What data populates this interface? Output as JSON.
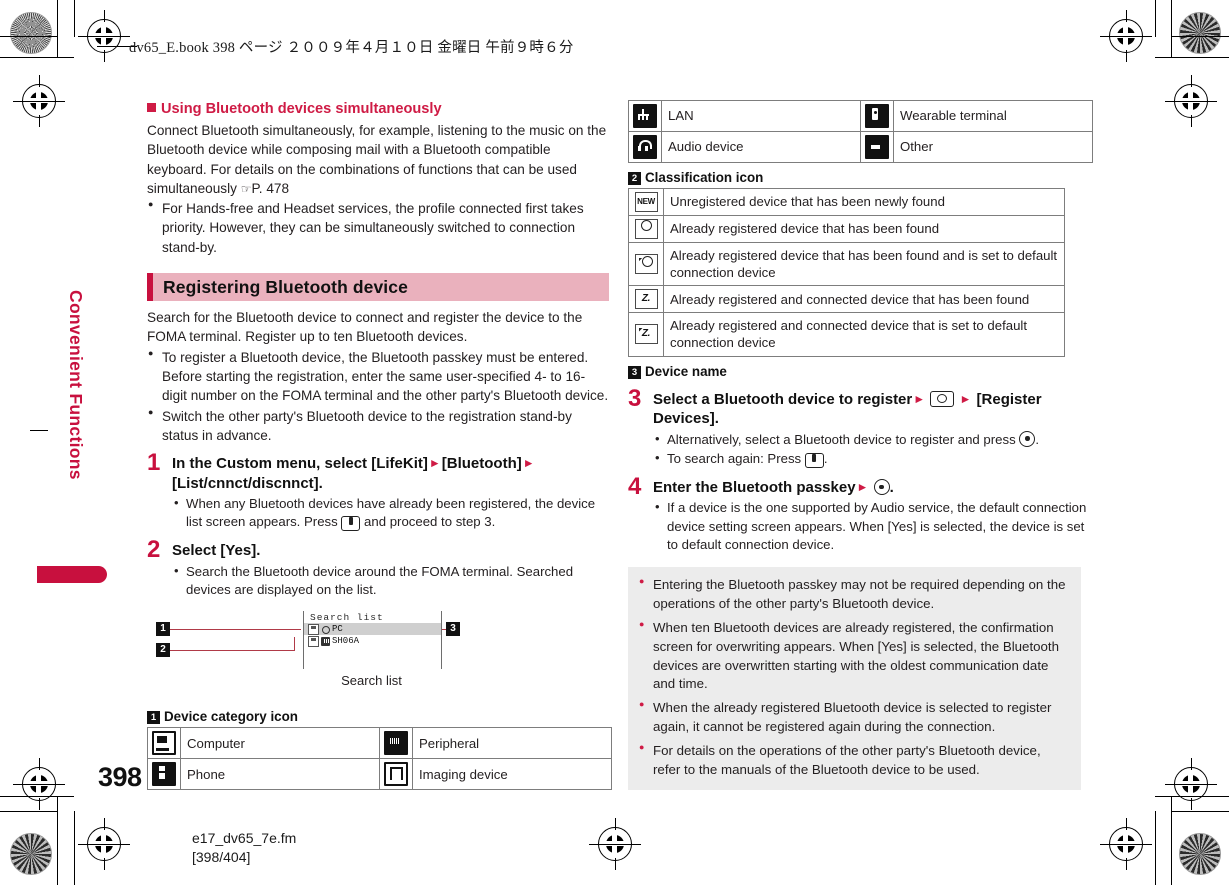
{
  "printer": {
    "running_head": "dv65_E.book   398 ページ   ２００９年４月１０日   金曜日   午前９時６分",
    "page_number": "398",
    "filename_line1": "e17_dv65_7e.fm",
    "filename_line2": "[398/404]"
  },
  "side_tab": {
    "label": "Convenient Functions"
  },
  "left_column": {
    "subhead": "Using Bluetooth devices simultaneously",
    "intro": "Connect Bluetooth simultaneously, for example, listening to the music on the Bluetooth device while composing mail with a Bluetooth compatible keyboard. For details on the combinations of functions that can be used simultaneously ",
    "intro_ref": "P. 478",
    "intro_bullets": [
      "For Hands-free and Headset services, the profile connected first takes priority. However, they can be simultaneously switched to connection stand-by."
    ],
    "section_title": "Registering Bluetooth device",
    "section_intro": "Search for the Bluetooth device to connect and register the device to the FOMA terminal. Register up to ten Bluetooth devices.",
    "section_bullets": [
      "To register a Bluetooth device, the Bluetooth passkey must be entered. Before starting the registration, enter the same user-specified 4- to 16-digit number on the FOMA terminal and the other party's Bluetooth device.",
      "Switch the other party's Bluetooth device to the registration stand-by status in advance."
    ],
    "steps": [
      {
        "num": "1",
        "title_a": "In the Custom menu, select [LifeKit]",
        "title_b": "[Bluetooth]",
        "title_c": "[List/cnnct/discnnct].",
        "notes_pre": "When any Bluetooth devices have already been registered, the device list screen appears. Press ",
        "notes_post": " and proceed to step 3."
      },
      {
        "num": "2",
        "title_a": "Select [Yes].",
        "notes": "Search the Bluetooth device around the FOMA terminal. Searched devices are displayed on the list."
      }
    ],
    "figure": {
      "screen_title": "Search list",
      "rows": [
        {
          "name": "PC",
          "selected": true
        },
        {
          "name": "SH06A",
          "selected": false
        }
      ],
      "caption": "Search list",
      "callouts": [
        "1",
        "2",
        "3"
      ]
    },
    "table1_caption_marker": "1",
    "table1_caption": "Device category icon",
    "table1_rows": [
      {
        "icon_left": "computer-icon",
        "label_left": "Computer",
        "icon_right": "peripheral-icon",
        "label_right": "Peripheral"
      },
      {
        "icon_left": "phone-icon",
        "label_left": "Phone",
        "icon_right": "imaging-device-icon",
        "label_right": "Imaging device"
      }
    ]
  },
  "right_column": {
    "table1_rows_cont": [
      {
        "icon_left": "lan-icon",
        "label_left": "LAN",
        "icon_right": "wearable-terminal-icon",
        "label_right": "Wearable terminal"
      },
      {
        "icon_left": "audio-device-icon",
        "label_left": "Audio device",
        "icon_right": "other-icon",
        "label_right": "Other"
      }
    ],
    "table2_caption_marker": "2",
    "table2_caption": "Classification icon",
    "table2_rows": [
      {
        "icon": "new-badge-icon",
        "label": "Unregistered device that has been newly found"
      },
      {
        "icon": "circle-icon",
        "label": "Already registered device that has been found"
      },
      {
        "icon": "circle-default-icon",
        "label": "Already registered device that has been found and is set to default connection device"
      },
      {
        "icon": "connected-icon",
        "label": "Already registered and connected device that has been found"
      },
      {
        "icon": "connected-default-icon",
        "label": "Already registered and connected device that is set to default connection device"
      }
    ],
    "table3_caption_marker": "3",
    "table3_caption": "Device name",
    "steps": [
      {
        "num": "3",
        "title_a": "Select a Bluetooth device to register",
        "title_b": "[Register Devices].",
        "notes": [
          {
            "pre": "Alternatively, select a Bluetooth device to register and press ",
            "post": "."
          },
          {
            "pre": "To search again: Press ",
            "post": "."
          }
        ]
      },
      {
        "num": "4",
        "title_a": "Enter the Bluetooth passkey",
        "title_b": ".",
        "notes": [
          {
            "pre": "If a device is the one supported by Audio service, the default connection device setting screen appears. When [Yes] is selected, the device is set to default connection device.",
            "post": ""
          }
        ]
      }
    ],
    "notes": [
      "Entering the Bluetooth passkey may not be required depending on the operations of the other party's Bluetooth device.",
      "When ten Bluetooth devices are already registered, the confirmation screen for overwriting appears. When [Yes] is selected, the Bluetooth devices are overwritten starting with the oldest communication date and time.",
      "When the already registered Bluetooth device is selected to register again, it cannot be registered again during the connection.",
      "For details on the operations of the other party's Bluetooth device, refer to the manuals of the Bluetooth device to be used."
    ]
  },
  "colors": {
    "accent_red": "#c8103e",
    "heading_pink_band": "#eab1bd",
    "note_gray": "#ececec"
  }
}
